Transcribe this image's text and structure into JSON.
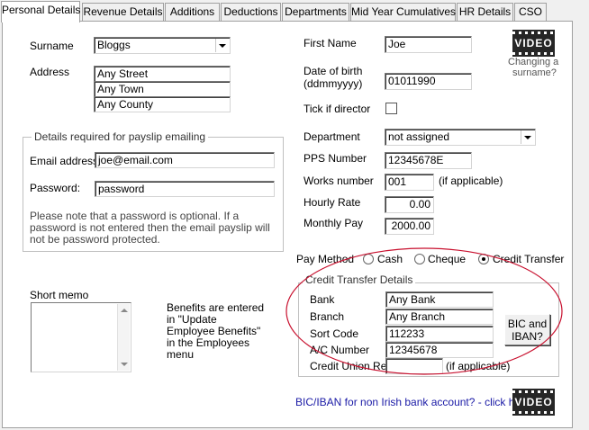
{
  "tabs": [
    "Personal Details",
    "Revenue Details",
    "Additions",
    "Deductions",
    "Departments",
    "Mid Year Cumulatives",
    "HR Details",
    "CSO"
  ],
  "left": {
    "surname_label": "Surname",
    "surname_value": "Bloggs",
    "address_label": "Address",
    "address_lines": [
      "Any Street",
      "Any Town",
      "Any County"
    ]
  },
  "video_help": {
    "text": "VIDEO",
    "caption_line1": "Changing a",
    "caption_line2": "surname?"
  },
  "right": {
    "first_name_label": "First Name",
    "first_name_value": "Joe",
    "dob_label_line1": "Date of birth",
    "dob_label_line2": "(ddmmyyyy)",
    "dob_value": "01011990",
    "director_label": "Tick if director",
    "department_label": "Department",
    "department_value": "not assigned",
    "pps_label": "PPS Number",
    "pps_value": "12345678E",
    "works_label": "Works number",
    "works_value": "001",
    "works_note": "(if applicable)",
    "hourly_label": "Hourly Rate",
    "hourly_value": "0.00",
    "monthly_label": "Monthly Pay",
    "monthly_value": "2000.00"
  },
  "email_group": {
    "title": "Details required for payslip emailing",
    "email_label": "Email address:",
    "email_value": "joe@email.com",
    "password_label": "Password:",
    "password_value": "password",
    "note": "Please note that a password is optional. If a password is not entered then the email payslip will not be password protected."
  },
  "memo": {
    "label": "Short memo"
  },
  "benefits_note": "Benefits are entered in \"Update Employee Benefits\" in the Employees menu",
  "pay_method": {
    "label": "Pay Method",
    "options": [
      "Cash",
      "Cheque",
      "Credit Transfer"
    ],
    "selected": "Credit Transfer"
  },
  "credit": {
    "title": "Credit Transfer Details",
    "bank_label": "Bank",
    "bank_value": "Any Bank",
    "branch_label": "Branch",
    "branch_value": "Any Branch",
    "sort_label": "Sort Code",
    "sort_value": "112233",
    "ac_label": "A/C Number",
    "ac_value": "12345678",
    "cu_label": "Credit Union Ref",
    "cu_value": "",
    "cu_note": "(if applicable)",
    "bic_button_line1": "BIC and",
    "bic_button_line2": "IBAN?"
  },
  "bic_link": "BIC/IBAN for non Irish bank account? - click here",
  "video_bottom": {
    "text": "VIDEO"
  },
  "colors": {
    "annotation_ellipse": "#c8102e",
    "link": "#1a1aa6"
  }
}
